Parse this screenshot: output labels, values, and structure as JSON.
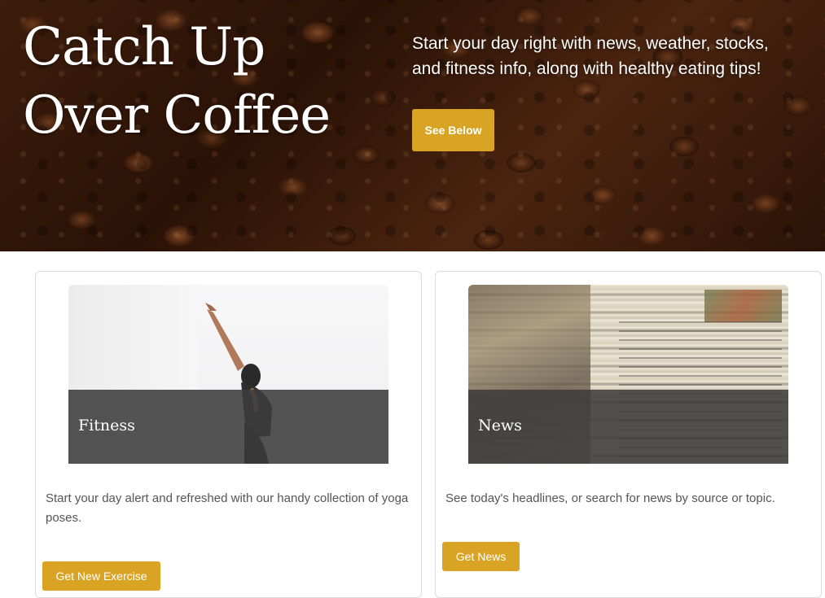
{
  "hero": {
    "title": "Catch Up Over Coffee",
    "tagline": "Start your day right with news, weather, stocks, and fitness info, along with healthy eating tips!",
    "button_label": "See Below"
  },
  "cards": {
    "fitness": {
      "title": "Fitness",
      "description": "Start your day alert and refreshed with our handy collection of yoga poses.",
      "button_label": "Get New Exercise"
    },
    "news": {
      "title": "News",
      "description": "See today's headlines, or search for news by source or topic.",
      "button_label": "Get News"
    }
  },
  "colors": {
    "accent": "#d9a423",
    "overlay": "#3c3c3c",
    "hero_background": "#3a1a0a"
  }
}
